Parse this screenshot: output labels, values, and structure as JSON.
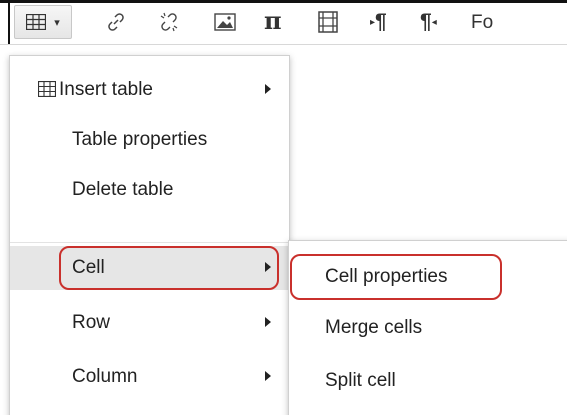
{
  "toolbar": {
    "table_button": {
      "icon": "table-grid-icon",
      "caret": "▾"
    },
    "buttons": [
      {
        "icon": "link-icon"
      },
      {
        "icon": "unlink-icon"
      },
      {
        "icon": "image-icon"
      },
      {
        "icon": "pi-icon",
        "glyph": "π"
      },
      {
        "icon": "film-icon"
      },
      {
        "icon": "paragraph-ltr-icon",
        "glyph": "¶"
      },
      {
        "icon": "paragraph-rtl-icon",
        "glyph": "¶"
      }
    ],
    "truncated_label": "Fo"
  },
  "menu": {
    "items": [
      {
        "label": "Insert table",
        "icon": "table-grid-icon",
        "submenu": true
      },
      {
        "label": "Table properties",
        "submenu": false
      },
      {
        "label": "Delete table",
        "submenu": false
      },
      {
        "label": "Cell",
        "submenu": true,
        "active": true
      },
      {
        "label": "Row",
        "submenu": true
      },
      {
        "label": "Column",
        "submenu": true
      }
    ]
  },
  "submenu": {
    "items": [
      {
        "label": "Cell properties",
        "highlighted": true
      },
      {
        "label": "Merge cells"
      },
      {
        "label": "Split cell"
      }
    ]
  },
  "colors": {
    "highlight_outline": "#c9302c",
    "active_row": "#e6e6e6",
    "text": "#222222"
  }
}
